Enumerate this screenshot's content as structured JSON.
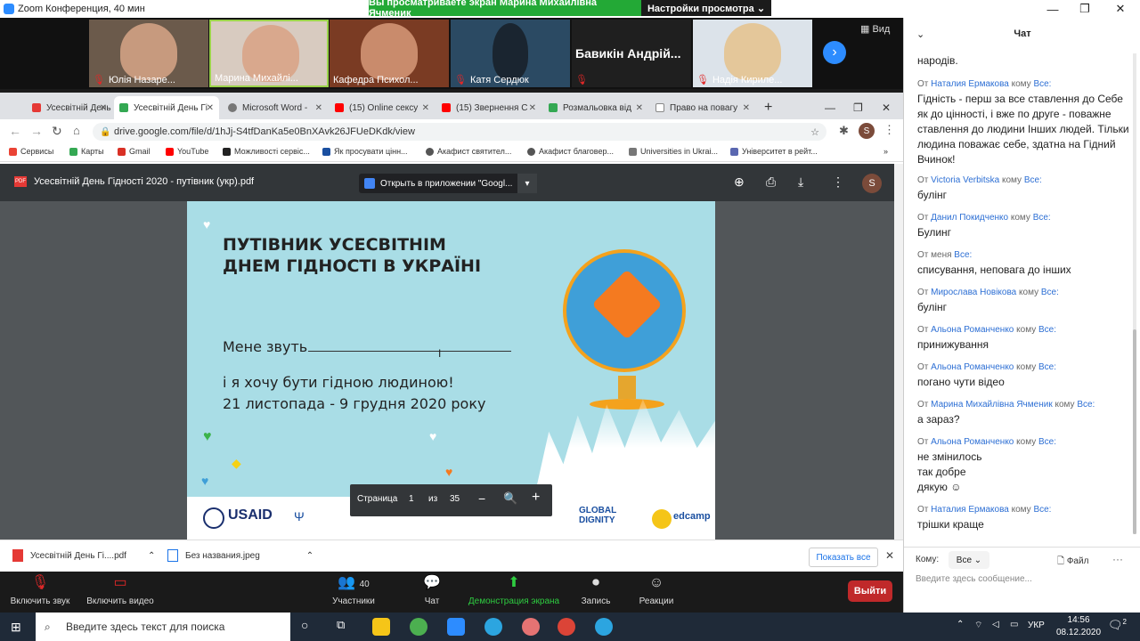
{
  "zoom": {
    "window_title": "Zoom Конференция, 40 мин",
    "share_banner": "Вы просматриваете экран Марина Михайлівна Ячменик",
    "view_options": "Настройки просмотра ⌄",
    "view_label": "Вид",
    "participants": [
      "Юлія Назаре...",
      "Марина Михайлі...",
      "Кафедра Психол...",
      "Катя Сердюк",
      "Бавикін Андрій...",
      "Надія Кириле..."
    ],
    "toolbar": {
      "mute": "Включить звук",
      "video": "Включить видео",
      "participants": "Участники",
      "participants_count": "40",
      "chat": "Чат",
      "share": "Демонстрация экрана",
      "record": "Запись",
      "reactions": "Реакции",
      "leave": "Выйти"
    }
  },
  "browser": {
    "tabs": [
      "Усесвітній День Гі",
      "Усесвітній День Гі",
      "Microsoft Word -",
      "(15) Online сексу",
      "(15) Звернення С",
      "Розмальовка від",
      "Право на повагу"
    ],
    "url": "drive.google.com/file/d/1hJj-S4tfDanKa5e0BnXAvk26JFUeDKdk/view",
    "profile": "S",
    "bookmarks": [
      "Сервисы",
      "Карты",
      "Gmail",
      "YouTube",
      "Можливості сервіс...",
      "Як просувати цінн...",
      "Акафист святител...",
      "Акафист благовер...",
      "Universities in Ukrai...",
      "Університет в рейт..."
    ],
    "pdf_title": "Усесвітній День Гідності 2020 - путівник (укр).pdf",
    "pdf_badge": "PDF",
    "open_in": "Открыть в приложении \"Googl...",
    "page_label": "Страница",
    "page_num": "1",
    "page_of": "из",
    "page_total": "35",
    "downloads": [
      "Усесвітній День Гі....pdf",
      "Без названия.jpeg"
    ],
    "show_all": "Показать все"
  },
  "pdf": {
    "title_line1": "ПУТІВНИК  УСЕСВІТНІМ",
    "title_line2": "ДНЕМ ГІДНОСТІ В УКРАЇНІ",
    "name_label": "Мене звуть",
    "line3": "і я хочу бути гідною людиною!",
    "dates": "21 листопада - 9 грудня 2020 року",
    "logos": [
      "USAID",
      "GLOBAL DIGNITY",
      "edcamp"
    ]
  },
  "chat": {
    "header": "Чат",
    "messages": [
      {
        "from": "",
        "to": "",
        "text": "народів."
      },
      {
        "from": "Наталия Ермакова",
        "to": "Все:",
        "text": "Гідність - перш за все ставлення до Себе як до цінності, і вже по друге - поважне ставлення до людини Інших людей. Тільки людина поважає себе, здатна на Гідний Вчинок!"
      },
      {
        "from": "Victoria Verbitska",
        "to": "Все:",
        "text": "булінг"
      },
      {
        "from": "Данил Покидченко",
        "to": "Все:",
        "text": "Булинг"
      },
      {
        "from": "меня",
        "to": "Все:",
        "text": "списування, неповага до інших"
      },
      {
        "from": "Мирослава Новікова",
        "to": "Все:",
        "text": "булінг"
      },
      {
        "from": "Альона Романченко",
        "to": "Все:",
        "text": "принижування"
      },
      {
        "from": "Альона Романченко",
        "to": "Все:",
        "text": "погано чути відео"
      },
      {
        "from": "Марина Михайлівна Ячменик",
        "to": "Все:",
        "text": "а зараз?"
      },
      {
        "from": "Альона Романченко",
        "to": "Все:",
        "text": "не змінилось\nтак добре\nдякую ☺"
      },
      {
        "from": "Наталия Ермакова",
        "to": "Все:",
        "text": "трішки краще"
      }
    ],
    "from_prefix": "От",
    "to_word": "кому",
    "to_label": "Кому:",
    "to_value": "Все",
    "file_label": "Файл",
    "input_placeholder": "Введите здесь сообщение..."
  },
  "taskbar": {
    "search_placeholder": "Введите здесь текст для поиска",
    "lang": "УКР",
    "time": "14:56",
    "date": "08.12.2020",
    "notif_count": "2"
  }
}
